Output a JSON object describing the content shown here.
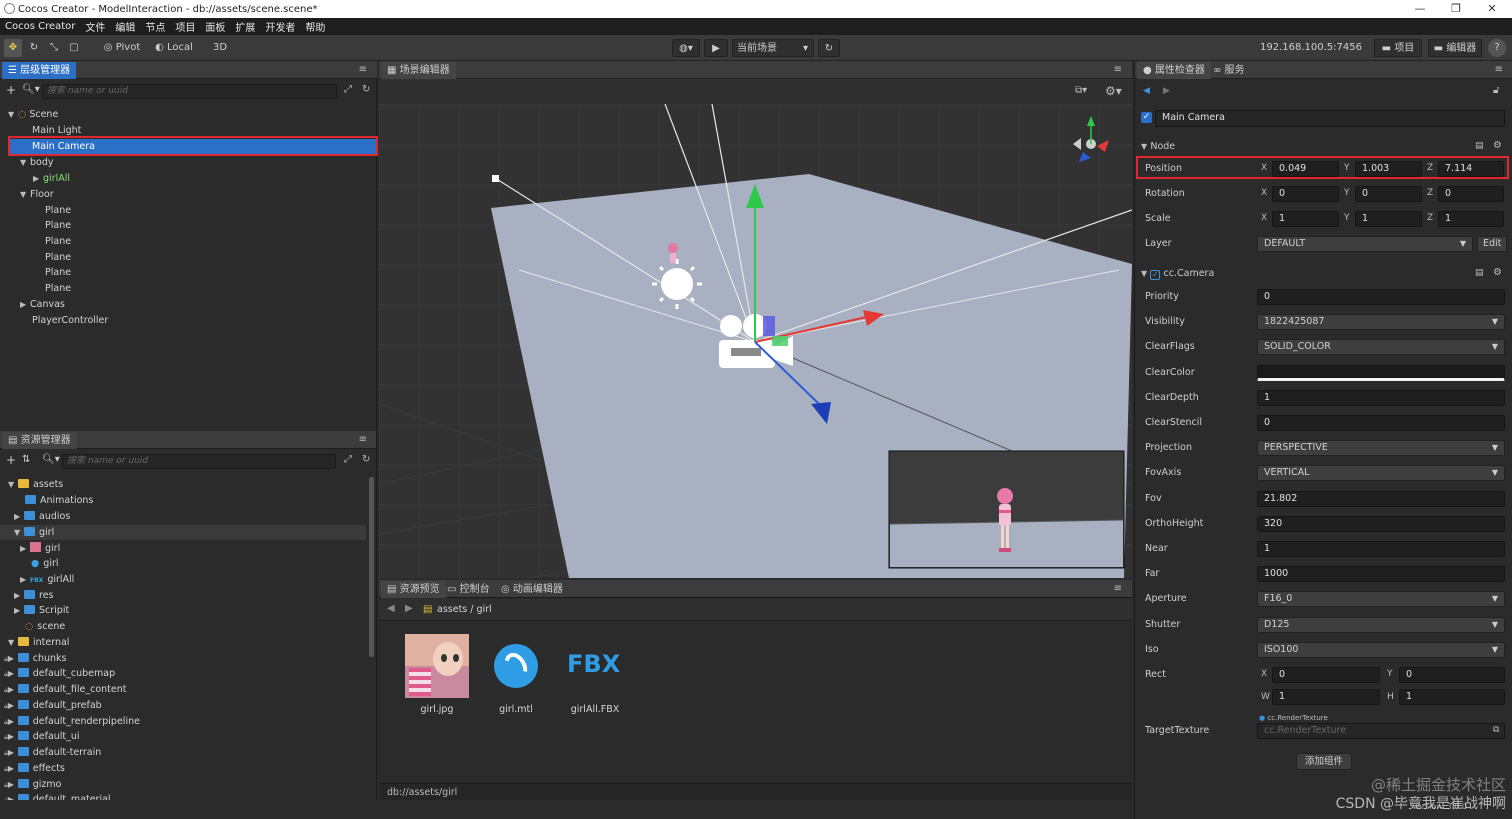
{
  "window": {
    "title": "Cocos Creator - ModelInteraction - db://assets/scene.scene*"
  },
  "menubar": [
    "Cocos Creator",
    "文件",
    "编辑",
    "节点",
    "项目",
    "面板",
    "扩展",
    "开发者",
    "帮助"
  ],
  "toolbar": {
    "pivot": "Pivot",
    "local": "Local",
    "mode3d": "3D",
    "scene_select": "当前场景",
    "ip": "192.168.100.5:7456",
    "project": "项目",
    "editor": "编辑器"
  },
  "hierarchy": {
    "tab": "层级管理器",
    "search_placeholder": "搜索 name or uuid",
    "rows": [
      "Scene",
      "Main Light",
      "Main Camera",
      "body",
      "girlAll",
      "Floor",
      "Plane",
      "Plane",
      "Plane",
      "Plane",
      "Plane",
      "Plane",
      "Canvas",
      "PlayerController"
    ]
  },
  "assets": {
    "tab": "资源管理器",
    "search_placeholder": "搜索 name or uuid",
    "rows": [
      "assets",
      "Animations",
      "audios",
      "girl",
      "girl",
      "girl",
      "girlAll",
      "res",
      "Scripit",
      "scene",
      "internal",
      "chunks",
      "default_cubemap",
      "default_file_content",
      "default_prefab",
      "default_renderpipeline",
      "default_ui",
      "default-terrain",
      "effects",
      "gizmo",
      "default_material"
    ],
    "fbx_tag": "FBX"
  },
  "scene": {
    "tab": "场景编辑器"
  },
  "bottom": {
    "tabs": [
      "资源预览",
      "控制台",
      "动画编辑器"
    ],
    "breadcrumb": "assets / girl",
    "items": [
      {
        "label": "girl.jpg"
      },
      {
        "label": "girl.mtl"
      },
      {
        "label": "girlAll.FBX",
        "icon_text": "FBX"
      }
    ],
    "status": "db://assets/girl"
  },
  "inspector": {
    "tabs": [
      "属性检查器",
      "服务"
    ],
    "node_name": "Main Camera",
    "node_section": "Node",
    "position": {
      "label": "Position",
      "x": "0.049",
      "y": "1.003",
      "z": "7.114"
    },
    "rotation": {
      "label": "Rotation",
      "x": "0",
      "y": "0",
      "z": "0"
    },
    "scale": {
      "label": "Scale",
      "x": "1",
      "y": "1",
      "z": "1"
    },
    "layer": {
      "label": "Layer",
      "value": "DEFAULT",
      "edit": "Edit"
    },
    "camera_section": "cc.Camera",
    "props": [
      {
        "label": "Priority",
        "value": "0",
        "kind": "field"
      },
      {
        "label": "Visibility",
        "value": "1822425087",
        "kind": "select"
      },
      {
        "label": "ClearFlags",
        "value": "SOLID_COLOR",
        "kind": "select"
      },
      {
        "label": "ClearColor",
        "value": "",
        "kind": "color"
      },
      {
        "label": "ClearDepth",
        "value": "1",
        "kind": "field"
      },
      {
        "label": "ClearStencil",
        "value": "0",
        "kind": "field"
      },
      {
        "label": "Projection",
        "value": "PERSPECTIVE",
        "kind": "select"
      },
      {
        "label": "FovAxis",
        "value": "VERTICAL",
        "kind": "select"
      },
      {
        "label": "Fov",
        "value": "21.802",
        "kind": "field"
      },
      {
        "label": "OrthoHeight",
        "value": "320",
        "kind": "field"
      },
      {
        "label": "Near",
        "value": "1",
        "kind": "field"
      },
      {
        "label": "Far",
        "value": "1000",
        "kind": "field"
      },
      {
        "label": "Aperture",
        "value": "F16_0",
        "kind": "select"
      },
      {
        "label": "Shutter",
        "value": "D125",
        "kind": "select"
      },
      {
        "label": "Iso",
        "value": "ISO100",
        "kind": "select"
      }
    ],
    "rect": {
      "label": "Rect",
      "x": "0",
      "y": "0",
      "w": "1",
      "h": "1"
    },
    "target_texture": {
      "label": "TargetTexture",
      "tag": "cc.RenderTexture",
      "placeholder": "cc.RenderTexture"
    },
    "add_component": "添加组件",
    "version": "Version: 3.0.0"
  },
  "watermark": {
    "line1": "@稀土掘金技术社区",
    "line2": "CSDN @毕竟我是崔战神啊"
  },
  "colors": {
    "accent": "#2b6fc6",
    "highlight_red": "#e0262e",
    "panel": "#2b2b2b",
    "floor": "#a8b0c2"
  }
}
